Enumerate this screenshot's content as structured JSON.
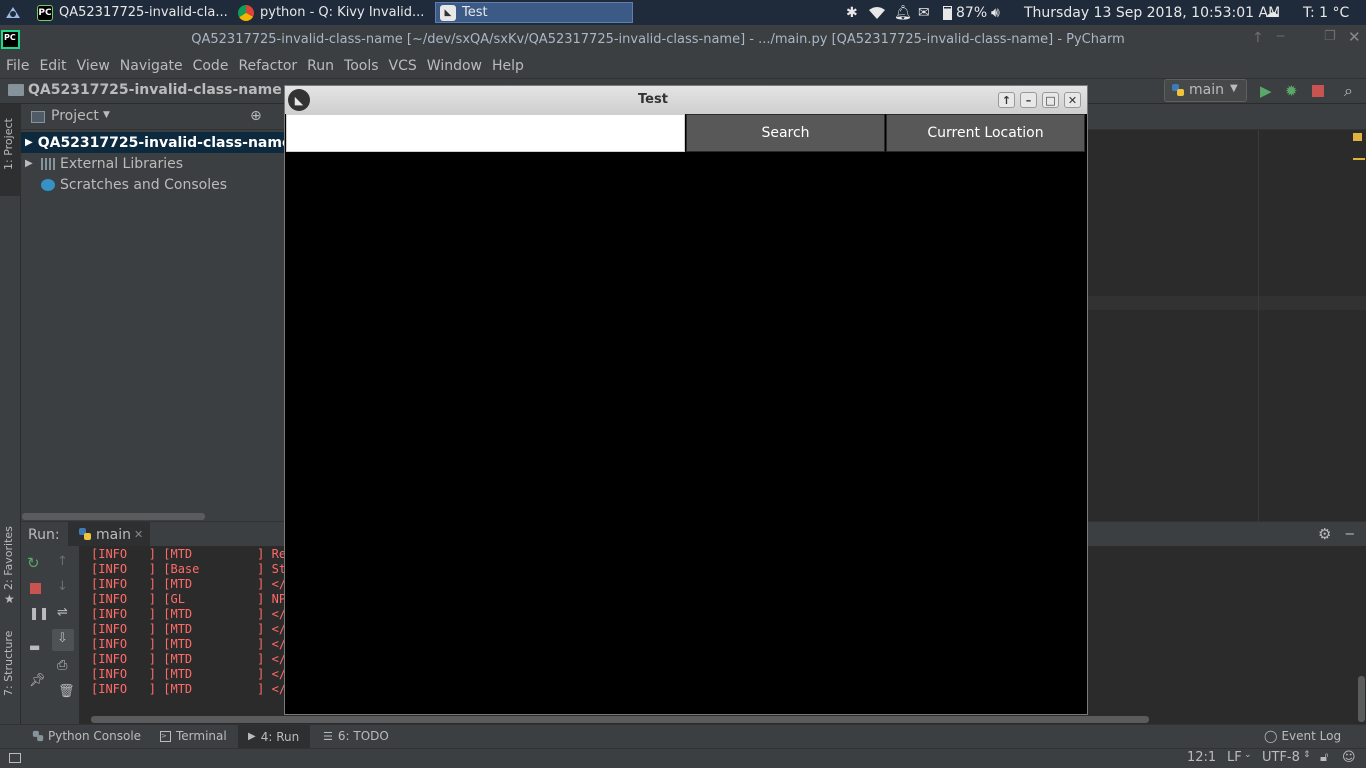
{
  "taskbar": {
    "tasks": [
      {
        "label": "QA52317725-invalid-cla..."
      },
      {
        "label": "python - Q: Kivy Invalid..."
      },
      {
        "label": "Test"
      }
    ],
    "battery": "87%",
    "datetime": "Thursday 13 Sep 2018, 10:53:01 AM",
    "temperature": "T: 1 °C"
  },
  "window": {
    "title": "QA52317725-invalid-class-name [~/dev/sxQA/sxKv/QA52317725-invalid-class-name] - .../main.py [QA52317725-invalid-class-name] - PyCharm",
    "app_icon": "PC"
  },
  "menu": [
    "File",
    "Edit",
    "View",
    "Navigate",
    "Code",
    "Refactor",
    "Run",
    "Tools",
    "VCS",
    "Window",
    "Help"
  ],
  "navbar": {
    "breadcrumb": "QA52317725-invalid-class-name",
    "run_config": "main"
  },
  "side_tabs": {
    "project": "1: Project",
    "favorites": "2: Favorites",
    "structure": "7: Structure"
  },
  "project_panel": {
    "title": "Project",
    "items": [
      {
        "label": "QA52317725-invalid-class-name"
      },
      {
        "label": "External Libraries"
      },
      {
        "label": "Scratches and Consoles"
      }
    ]
  },
  "run_panel": {
    "label": "Run:",
    "tab": "main",
    "log_lines": [
      "[INFO   ] [MTD         ] Rea",
      "[INFO   ] [Base        ] Sta",
      "[INFO   ] [MTD         ] </c",
      "[INFO   ] [GL          ] NPO",
      "[INFO   ] [MTD         ] </c",
      "[INFO   ] [MTD         ] </c",
      "[INFO   ] [MTD         ] </c",
      "[INFO   ] [MTD         ] </c",
      "[INFO   ] [MTD         ] </c",
      "[INFO   ] [MTD         ] </c"
    ]
  },
  "bottom_tabs": [
    "Python Console",
    "Terminal",
    "4: Run",
    "6: TODO"
  ],
  "event_log": "Event Log",
  "status": {
    "position": "12:1",
    "line_sep": "LF",
    "encoding": "UTF-8"
  },
  "kivy_window": {
    "title": "Test",
    "search_input_value": "",
    "search_button": "Search",
    "location_button": "Current Location"
  },
  "colors": {
    "ide_bg": "#3c3f41",
    "editor_bg": "#2b2b2b",
    "log_text": "#ff6b68",
    "kivy_button": "#585858"
  }
}
